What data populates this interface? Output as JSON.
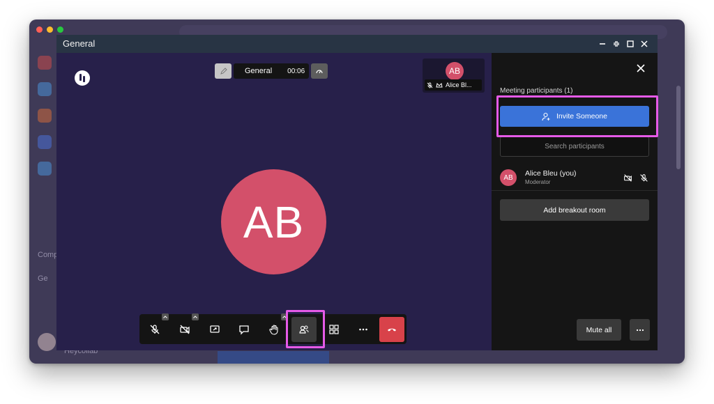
{
  "background_app": {
    "partial_labels": [
      "Comp",
      "Ge",
      "Heycollab"
    ]
  },
  "window": {
    "title": "General",
    "controls": [
      "minimize-icon",
      "exit-fullscreen-icon",
      "maximize-icon",
      "close-icon"
    ]
  },
  "meeting": {
    "room_name": "General",
    "timer": "00:06",
    "self_view": {
      "initials": "AB",
      "label": "Alice Bl..."
    },
    "main_avatar_initials": "AB",
    "toolbar": [
      "mic-off-icon",
      "camera-off-icon",
      "share-screen-icon",
      "chat-icon",
      "raise-hand-icon",
      "participants-icon",
      "tile-view-icon",
      "more-icon",
      "hang-up-icon"
    ]
  },
  "participants_panel": {
    "heading": "Meeting participants (1)",
    "invite_label": "Invite Someone",
    "search_placeholder": "Search participants",
    "participants": [
      {
        "initials": "AB",
        "name": "Alice Bleu (you)",
        "role": "Moderator"
      }
    ],
    "breakout_label": "Add breakout room",
    "mute_all_label": "Mute all"
  },
  "colors": {
    "stage": "#27204a",
    "avatar": "#d3506a",
    "invite": "#3a73d9",
    "hangup": "#d8424a",
    "highlight": "#e65ae8",
    "panel": "#151515"
  }
}
